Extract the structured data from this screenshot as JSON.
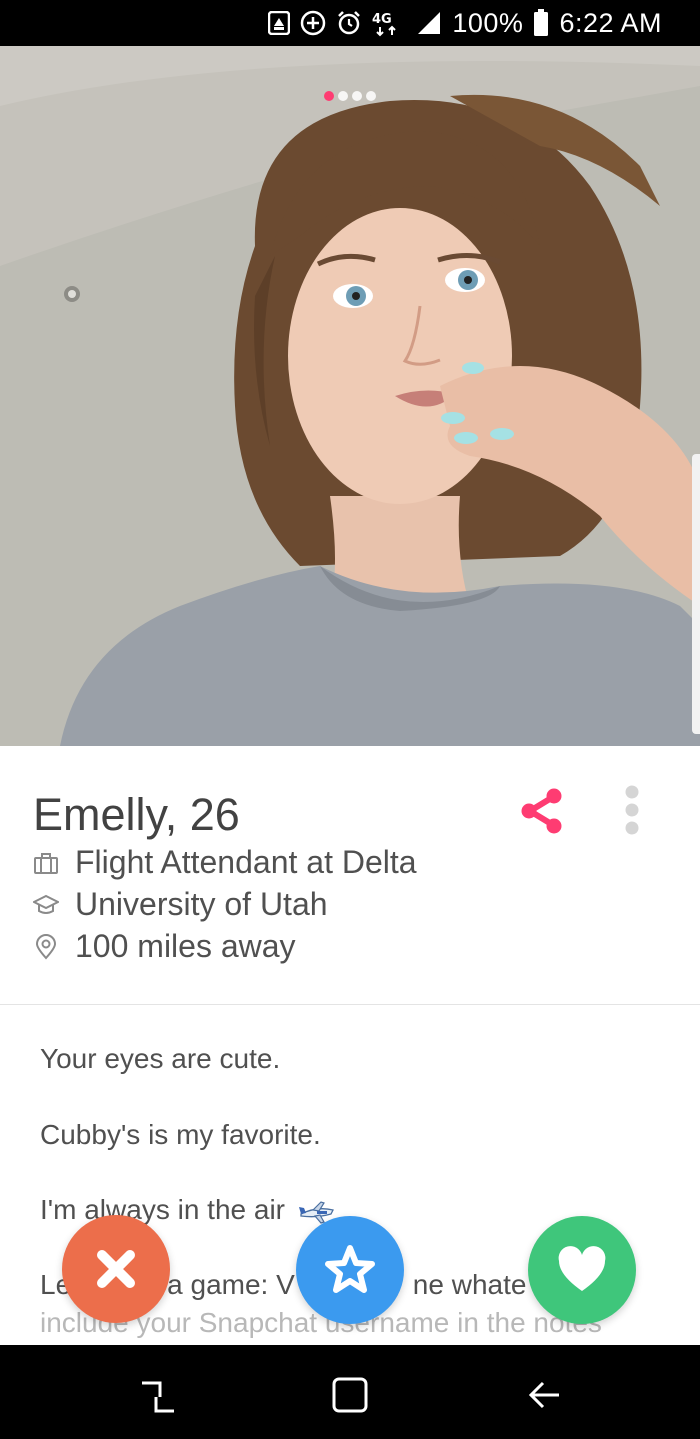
{
  "status_bar": {
    "network": "4G",
    "battery": "100%",
    "time": "6:22 AM",
    "icons": [
      "notification-badge-icon",
      "add-circle-icon",
      "alarm-icon",
      "lte-icon",
      "signal-icon",
      "battery-icon"
    ]
  },
  "photo": {
    "dot_count": 4,
    "active_dot": 0
  },
  "profile": {
    "name": "Emelly",
    "age": "26",
    "job": "Flight Attendant at Delta",
    "school": "University of Utah",
    "distance": "100 miles away"
  },
  "bio": {
    "line1": "Your eyes are cute.",
    "line2": "Cubby's is my favorite.",
    "line3": "I'm always in the air",
    "line4_a": "Le",
    "line4_b": "a game: V",
    "line4_c": "ne whate",
    "line5": "include your Snapchat username in the notes"
  },
  "colors": {
    "brand_pink": "#fe3c72",
    "nope": "#ec6e4b",
    "super_like": "#3b9aef",
    "like": "#3fc67b"
  },
  "actions": {
    "nope_icon": "close-icon",
    "super_icon": "star-icon",
    "like_icon": "heart-icon"
  }
}
